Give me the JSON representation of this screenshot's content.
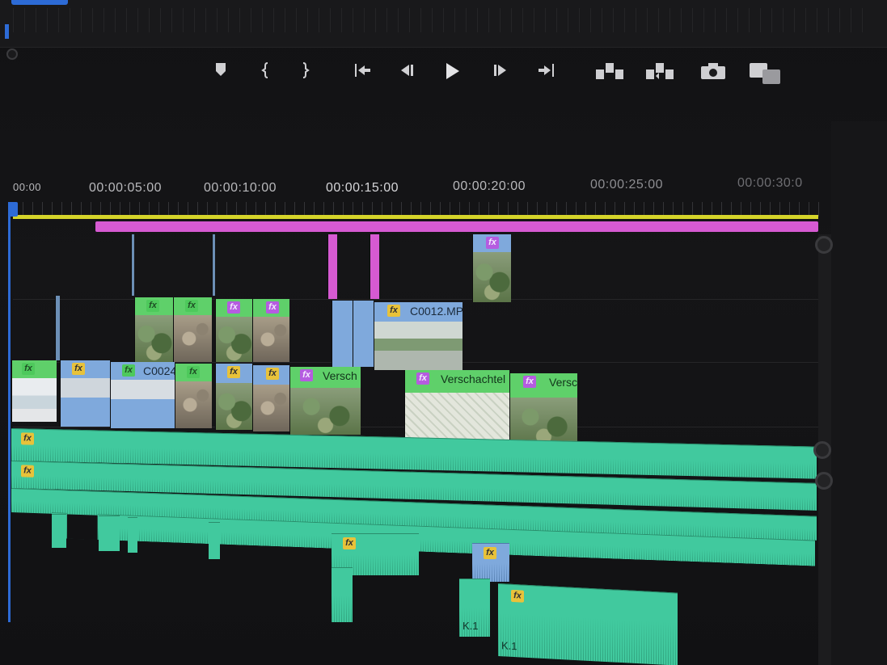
{
  "transport": {
    "buttons": [
      "add-marker",
      "mark-in",
      "mark-out",
      "go-to-in",
      "step-back",
      "play",
      "step-forward",
      "go-to-out",
      "lift",
      "extract",
      "export-frame",
      "compare"
    ]
  },
  "ruler": {
    "timecodes": [
      "00:00",
      "00:00:05:00",
      "00:00:10:00",
      "00:00:15:00",
      "00:00:20:00",
      "00:00:25:00",
      "00:00:30:0"
    ]
  },
  "clips": {
    "v2_c0012": "C0012.MP",
    "v1_c0024": "C0024",
    "v1_verschachtelt_a": "Versch",
    "v1_verschachtelt_b": "Verschachtel",
    "v1_verschachtelt_c": "Versc",
    "a_k1_a": "K.1",
    "a_k1_b": "K.1"
  },
  "fx_label": "fx",
  "colors": {
    "playhead": "#2d6bd6",
    "work_area": "#d5d42a",
    "in_out": "#d65ad2",
    "video_green": "#5fd06a",
    "video_blue": "#7fa9dc",
    "audio": "#41c99e"
  }
}
